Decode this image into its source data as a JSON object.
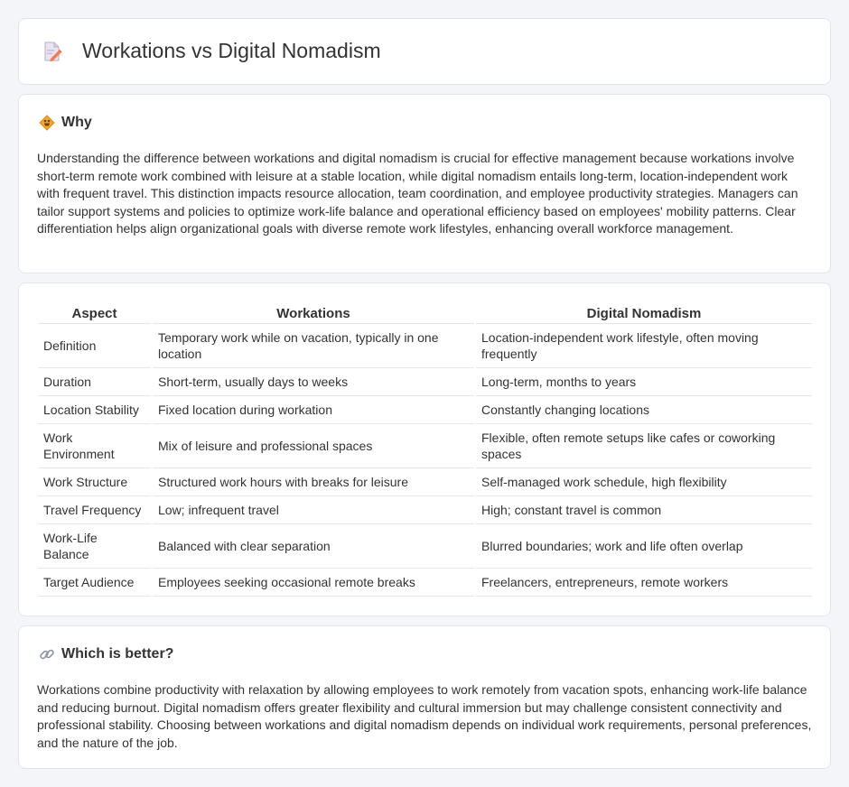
{
  "header": {
    "title": "Workations vs Digital Nomadism",
    "icon": "document-pencil-icon"
  },
  "why": {
    "title": "Why",
    "icon": "diamond-sign-icon",
    "text": "Understanding the difference between workations and digital nomadism is crucial for effective management because workations involve short-term remote work combined with leisure at a stable location, while digital nomadism entails long-term, location-independent work with frequent travel. This distinction impacts resource allocation, team coordination, and employee productivity strategies. Managers can tailor support systems and policies to optimize work-life balance and operational efficiency based on employees' mobility patterns. Clear differentiation helps align organizational goals with diverse remote work lifestyles, enhancing overall workforce management."
  },
  "table": {
    "headers": [
      "Aspect",
      "Workations",
      "Digital Nomadism"
    ],
    "rows": [
      [
        "Definition",
        "Temporary work while on vacation, typically in one location",
        "Location-independent work lifestyle, often moving frequently"
      ],
      [
        "Duration",
        "Short-term, usually days to weeks",
        "Long-term, months to years"
      ],
      [
        "Location Stability",
        "Fixed location during workation",
        "Constantly changing locations"
      ],
      [
        "Work Environment",
        "Mix of leisure and professional spaces",
        "Flexible, often remote setups like cafes or coworking spaces"
      ],
      [
        "Work Structure",
        "Structured work hours with breaks for leisure",
        "Self-managed work schedule, high flexibility"
      ],
      [
        "Travel Frequency",
        "Low; infrequent travel",
        "High; constant travel is common"
      ],
      [
        "Work-Life Balance",
        "Balanced with clear separation",
        "Blurred boundaries; work and life often overlap"
      ],
      [
        "Target Audience",
        "Employees seeking occasional remote breaks",
        "Freelancers, entrepreneurs, remote workers"
      ]
    ]
  },
  "better": {
    "title": "Which is better?",
    "icon": "link-icon",
    "text": "Workations combine productivity with relaxation by allowing employees to work remotely from vacation spots, enhancing work-life balance and reducing burnout. Digital nomadism offers greater flexibility and cultural immersion but may challenge consistent connectivity and professional stability. Choosing between workations and digital nomadism depends on individual work requirements, personal preferences, and the nature of the job."
  },
  "colors": {
    "background": "#f3f5f9",
    "card": "#ffffff",
    "border": "#e2e6ec",
    "text": "#333333",
    "accent_orange": "#f0a030"
  }
}
